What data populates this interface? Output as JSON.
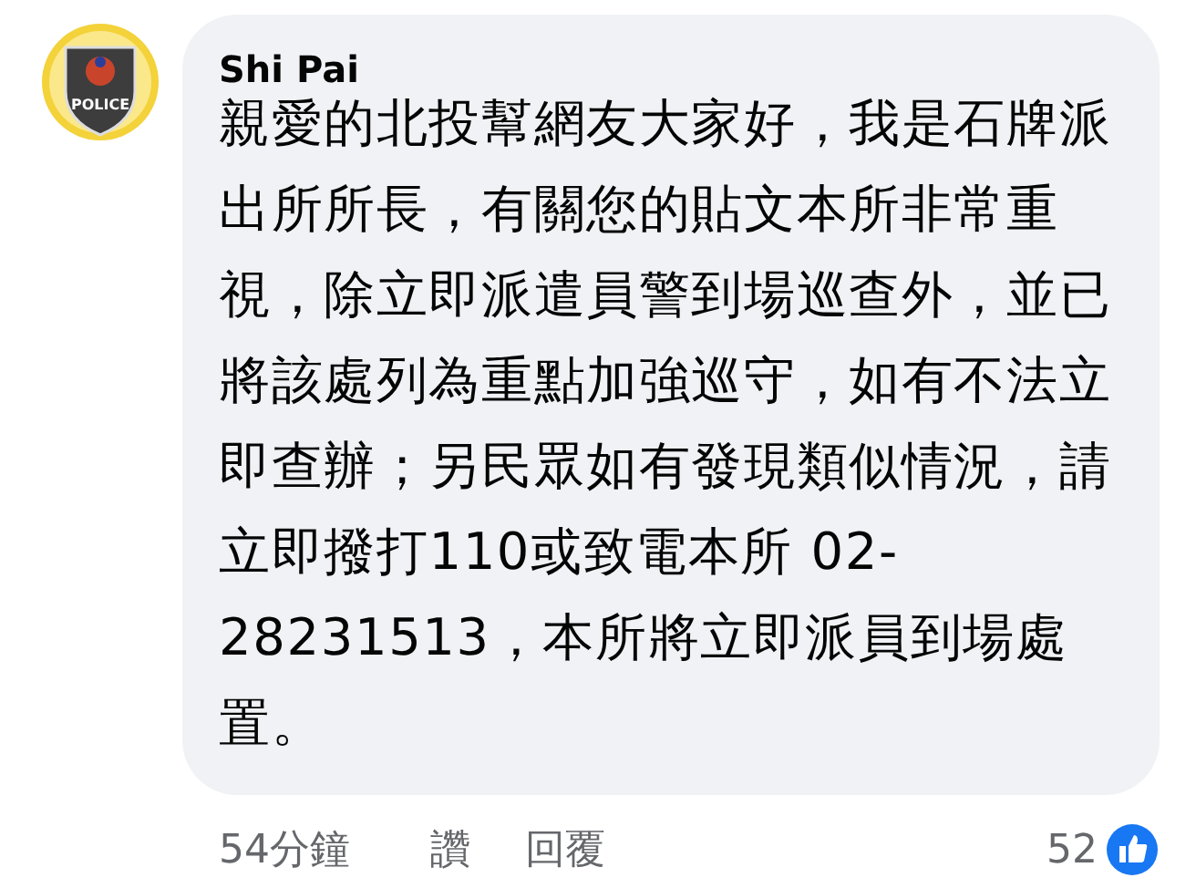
{
  "comment": {
    "avatar_text": "POLICE",
    "author": "Shi Pai",
    "body": "親愛的北投幫網友大家好，我是石牌派出所所長，有關您的貼文本所非常重視，除立即派遣員警到場巡查外，並已將該處列為重點加強巡守，如有不法立即查辦；另民眾如有發現類似情況，請立即撥打110或致電本所 02-28231513，本所將立即派員到場處置。",
    "time": "54分鐘",
    "actions": [
      "讚",
      "回覆"
    ],
    "reaction_count": "52"
  }
}
